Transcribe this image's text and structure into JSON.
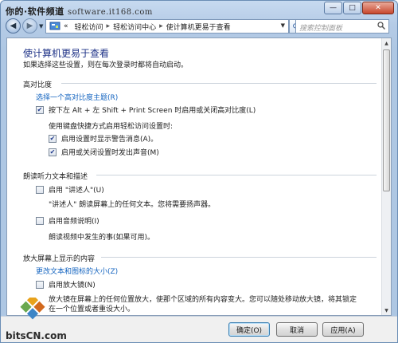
{
  "watermark": {
    "site": "你的·软件频道",
    "url": "software.it168.com"
  },
  "caption": {
    "minimize": "—",
    "maximize": "□",
    "close": "✕"
  },
  "nav": {
    "back_label": "◀",
    "forward_label": "▶",
    "address": {
      "prefix": "«",
      "crumbs": [
        "轻松访问",
        "轻松访问中心",
        "使计算机更易于查看"
      ],
      "separator": "▸"
    },
    "search_placeholder": "搜索控制面板"
  },
  "page": {
    "title": "使计算机更易于查看",
    "description": "如果选择这些设置，则在每次登录时都将自动启动。"
  },
  "sections": {
    "high_contrast": {
      "heading": "高对比度",
      "link": "选择一个高对比度主题(R)",
      "toggle_label": "按下左 Alt + 左 Shift + Print Screen 时启用或关闭高对比度(L)",
      "toggle_checked": true,
      "shortcut_note": "使用键盘快捷方式启用轻松访问设置时:",
      "warn_label": "启用设置时显示警告消息(A)。",
      "warn_checked": true,
      "sound_label": "启用或关闭设置时发出声音(M)",
      "sound_checked": true
    },
    "narrator": {
      "heading": "朗读听力文本和描述",
      "narrator_label": "启用 \"讲述人\"(U)",
      "narrator_checked": false,
      "narrator_desc": "\"讲述人\" 朗读屏幕上的任何文本。您将需要扬声器。",
      "audio_label": "启用音频说明(I)",
      "audio_checked": false,
      "audio_desc": "朗读视频中发生的事(如果可用)。"
    },
    "magnify": {
      "heading": "放大屏幕上显示的内容",
      "link": "更改文本和图标的大小(Z)",
      "magnifier_label": "启用放大镜(N)",
      "magnifier_checked": false,
      "magnifier_desc": "放大镜在屏幕上的任何位置放大，使那个区域的所有内容变大。您可以随处移动放大镜，将其锁定在一个位置或者重设大小。"
    }
  },
  "buttons": {
    "ok": "确定(O)",
    "cancel": "取消",
    "apply": "应用(A)"
  },
  "logo_text": "bitsCN.com",
  "check_mark": "✔"
}
